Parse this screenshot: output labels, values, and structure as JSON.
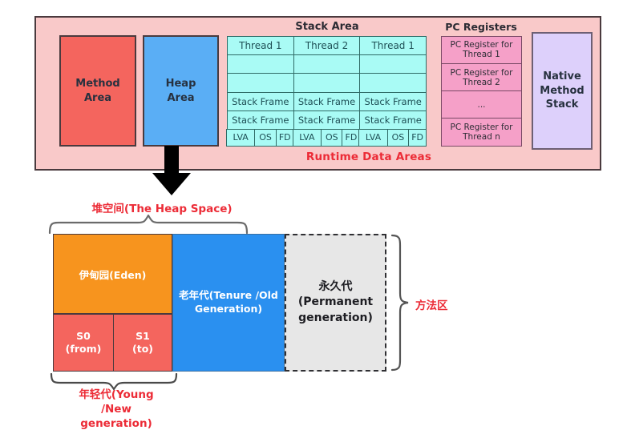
{
  "runtime": {
    "caption": "Runtime Data Areas",
    "method_area": "Method\nArea",
    "heap_area": "Heap\nArea",
    "native_method_stack": "Native\nMethod\nStack",
    "stack_area_title": "Stack Area",
    "pc_registers_title": "PC Registers",
    "threads": [
      {
        "name": "Thread 1",
        "empty1": "",
        "empty2": "",
        "frame1": "Stack Frame",
        "frame2": "Stack Frame",
        "lva": "LVA",
        "os": "OS",
        "fd": "FD"
      },
      {
        "name": "Thread 2",
        "empty1": "",
        "empty2": "",
        "frame1": "Stack Frame",
        "frame2": "Stack Frame",
        "lva": "LVA",
        "os": "OS",
        "fd": "FD"
      },
      {
        "name": "Thread 1",
        "empty1": "",
        "empty2": "",
        "frame1": "Stack Frame",
        "frame2": "Stack Frame",
        "lva": "LVA",
        "os": "OS",
        "fd": "FD"
      }
    ],
    "pc_registers": [
      "PC Register for Thread 1",
      "PC Register for Thread 2",
      "...",
      "PC Register for Thread n"
    ]
  },
  "heap": {
    "space_label": "堆空间(The Heap Space)",
    "eden": "伊甸园(Eden)",
    "s0": "S0\n(from)",
    "s1": "S1\n(to)",
    "tenured": "老年代(Tenure /Old Generation)",
    "permanent": "永久代\n(Permanent\ngeneration)",
    "method_zone_label": "方法区",
    "young_label": "年轻代(Young\n/New\ngeneration)"
  },
  "colors": {
    "panel_bg": "#f9c9c9",
    "method_area": "#f4655e",
    "heap_area": "#5aaef5",
    "stack_cell": "#a9fbf5",
    "pc_cell": "#f5a0c8",
    "native_stack": "#ddd0fb",
    "eden": "#f7941e",
    "survivor": "#f4655e",
    "tenured": "#2a90f0",
    "permanent": "#e7e7e7",
    "accent_red": "#ec2b36"
  }
}
